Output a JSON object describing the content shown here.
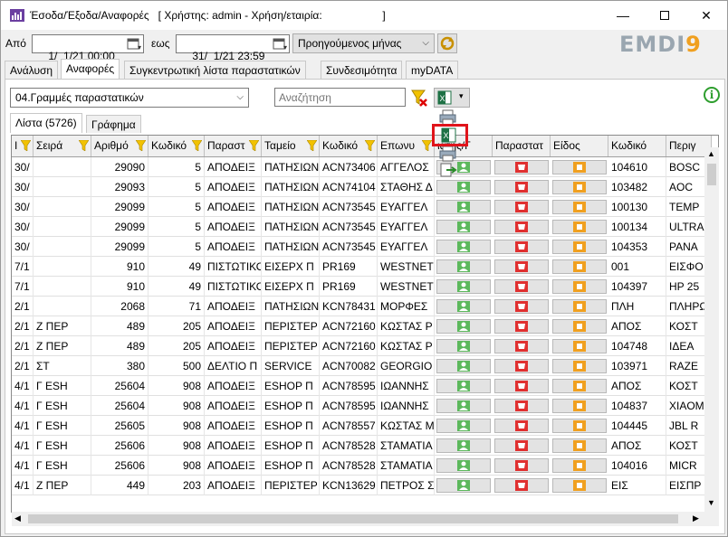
{
  "window": {
    "title": "Έσοδα/Έξοδα/Αναφορές   [ Χρήστης: admin - Χρήση/εταιρία:                    ]",
    "minimize_icon": "minimize-icon",
    "maximize_icon": "maximize-icon",
    "close_icon": "close-icon"
  },
  "filter": {
    "from_label": "Από",
    "from_date": "1/  1/21 00:00",
    "to_label": "εως",
    "to_date": "31/  1/21 23:59",
    "period_value": "Προηγούμενος μήνας",
    "refresh_icon": "refresh-icon"
  },
  "logo": {
    "part1": "EMDI",
    "part2": "9"
  },
  "main_tabs": [
    {
      "label": "Ανάλυση"
    },
    {
      "label": "Αναφορές"
    },
    {
      "label": "Συγκεντρωτική λίστα παραστατικών"
    },
    {
      "label": "Συνδεσιμότητα"
    },
    {
      "label": "myDATA"
    }
  ],
  "report": {
    "selected": "04.Γραμμές παραστατικών",
    "search_placeholder": "Αναζήτηση"
  },
  "sub_tabs": [
    {
      "label": "Λίστα (5726)"
    },
    {
      "label": "Γράφημα"
    }
  ],
  "columns": [
    {
      "label": "Ι"
    },
    {
      "label": "Σειρά"
    },
    {
      "label": "Αριθμό"
    },
    {
      "label": "Κωδικό"
    },
    {
      "label": "Παραστ"
    },
    {
      "label": "Ταμείο"
    },
    {
      "label": "Κωδικό"
    },
    {
      "label": "Επωνυ"
    },
    {
      "label": "ιάτης/Γ"
    },
    {
      "label": "Παραστατ"
    },
    {
      "label": "Είδος"
    },
    {
      "label": "Κωδικό"
    },
    {
      "label": "Περιγ"
    }
  ],
  "rows": [
    [
      "30/",
      "",
      "29090",
      "5",
      "ΑΠΟΔΕΙΞ",
      "ΠΑΤΗΣΙΩΝ",
      "ACN73406",
      "ΑΓΓΕΛΟΣ",
      "104610",
      "BOSC"
    ],
    [
      "30/",
      "",
      "29093",
      "5",
      "ΑΠΟΔΕΙΞ",
      "ΠΑΤΗΣΙΩΝ",
      "ACN74104",
      "ΣΤΑΘΗΣ Δ",
      "103482",
      "AOC"
    ],
    [
      "30/",
      "",
      "29099",
      "5",
      "ΑΠΟΔΕΙΞ",
      "ΠΑΤΗΣΙΩΝ",
      "ACN73545",
      "ΕΥΑΓΓΕΛ",
      "100130",
      "TEMP"
    ],
    [
      "30/",
      "",
      "29099",
      "5",
      "ΑΠΟΔΕΙΞ",
      "ΠΑΤΗΣΙΩΝ",
      "ACN73545",
      "ΕΥΑΓΓΕΛ",
      "100134",
      "ULTRA"
    ],
    [
      "30/",
      "",
      "29099",
      "5",
      "ΑΠΟΔΕΙΞ",
      "ΠΑΤΗΣΙΩΝ",
      "ACN73545",
      "ΕΥΑΓΓΕΛ",
      "104353",
      "PANA"
    ],
    [
      "7/1",
      "",
      "910",
      "49",
      "ΠΙΣΤΩΤΙΚΟ",
      "ΕΙΣΕΡΧ Π",
      "PR169",
      "WESTNET",
      "001",
      "ΕΙΣΦΟ"
    ],
    [
      "7/1",
      "",
      "910",
      "49",
      "ΠΙΣΤΩΤΙΚΟ",
      "ΕΙΣΕΡΧ Π",
      "PR169",
      "WESTNET",
      "104397",
      "HP 25"
    ],
    [
      "2/1",
      "",
      "2068",
      "71",
      "ΑΠΟΔΕΙΞ",
      "ΠΑΤΗΣΙΩΝ",
      "KCN78431",
      "ΜΟΡΦΕΣ",
      "ΠΛΗ",
      "ΠΛΗΡΩ"
    ],
    [
      "2/1",
      "Ζ ΠΕΡ",
      "489",
      "205",
      "ΑΠΟΔΕΙΞ",
      "ΠΕΡΙΣΤΕΡ",
      "ACN72160",
      "ΚΩΣΤΑΣ Ρ",
      "ΑΠΟΣ",
      "ΚΟΣΤ"
    ],
    [
      "2/1",
      "Ζ ΠΕΡ",
      "489",
      "205",
      "ΑΠΟΔΕΙΞ",
      "ΠΕΡΙΣΤΕΡ",
      "ACN72160",
      "ΚΩΣΤΑΣ Ρ",
      "104748",
      "ΙΔΕΑ"
    ],
    [
      "2/1",
      "ΣΤ",
      "380",
      "500",
      "ΔΕΛΤΙΟ Π",
      "SERVICE",
      "ACN70082",
      "GEORGIO",
      "103971",
      "RAZE"
    ],
    [
      "4/1",
      "Γ ESH",
      "25604",
      "908",
      "ΑΠΟΔΕΙΞ",
      "ESHOP Π",
      "ACN78595",
      "ΙΩΑΝΝΗΣ",
      "ΑΠΟΣ",
      "ΚΟΣΤ"
    ],
    [
      "4/1",
      "Γ ESH",
      "25604",
      "908",
      "ΑΠΟΔΕΙΞ",
      "ESHOP Π",
      "ACN78595",
      "ΙΩΑΝΝΗΣ",
      "104837",
      "XIAOM"
    ],
    [
      "4/1",
      "Γ ESH",
      "25605",
      "908",
      "ΑΠΟΔΕΙΞ",
      "ESHOP Π",
      "ACN78557",
      "ΚΩΣΤΑΣ Μ",
      "104445",
      "JBL R"
    ],
    [
      "4/1",
      "Γ ESH",
      "25606",
      "908",
      "ΑΠΟΔΕΙΞ",
      "ESHOP Π",
      "ACN78528",
      "ΣΤΑΜΑΤΙΑ",
      "ΑΠΟΣ",
      "ΚΟΣΤ"
    ],
    [
      "4/1",
      "Γ ESH",
      "25606",
      "908",
      "ΑΠΟΔΕΙΞ",
      "ESHOP Π",
      "ACN78528",
      "ΣΤΑΜΑΤΙΑ",
      "104016",
      "MICR"
    ],
    [
      "4/1",
      "Ζ ΠΕΡ",
      "449",
      "203",
      "ΑΠΟΔΕΙΞ",
      "ΠΕΡΙΣΤΕΡ",
      "KCN13629",
      "ΠΕΤΡΟΣ Σ",
      "ΕΙΣ",
      "ΕΙΣΠΡ"
    ]
  ],
  "colors": {
    "accent_red": "#e0141b",
    "green": "#5cb85c",
    "orange": "#f0a020"
  }
}
